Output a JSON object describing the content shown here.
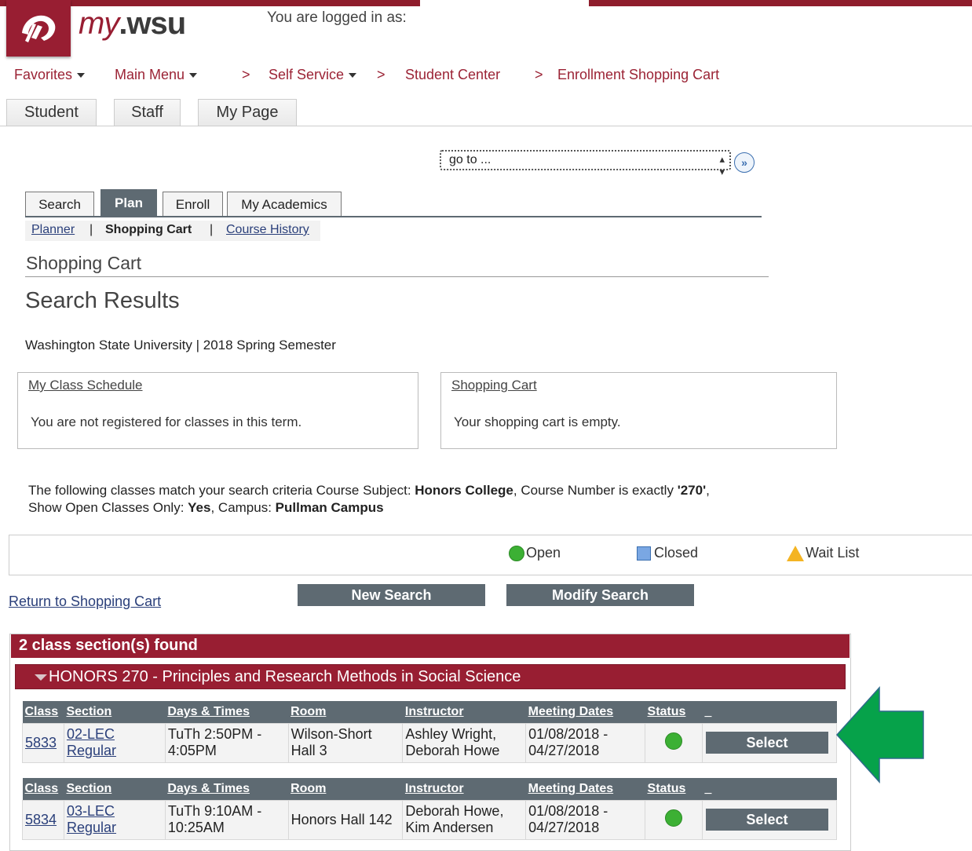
{
  "header": {
    "logo_text_my": "my",
    "logo_text_wsu": ".wsu",
    "logged_in_label": "You are logged in as:"
  },
  "nav": {
    "favorites": "Favorites",
    "main_menu": "Main Menu",
    "self_service": "Self Service",
    "student_center": "Student Center",
    "enrollment_cart": "Enrollment Shopping Cart",
    "separator": ">"
  },
  "top_tabs": [
    "Student",
    "Staff",
    "My Page"
  ],
  "goto": {
    "value": "go to ...",
    "button_symbol": "»"
  },
  "sub_tabs": {
    "search": "Search",
    "plan": "Plan",
    "enroll": "Enroll",
    "my_academics": "My Academics"
  },
  "sub_nav": {
    "planner": "Planner",
    "shopping_cart": "Shopping Cart",
    "course_history": "Course History",
    "separator": "|"
  },
  "page": {
    "section_title": "Shopping Cart",
    "results_title": "Search Results",
    "term": "Washington State University | 2018 Spring Semester"
  },
  "schedule_box": {
    "title": "My Class Schedule",
    "body": "You are not registered for classes in this term."
  },
  "cart_box": {
    "title": "Shopping Cart",
    "body": "Your shopping cart is empty."
  },
  "criteria": {
    "t1": "The following classes match your search criteria Course Subject: ",
    "subject": "Honors College",
    "t2": ",  Course Number is exactly ",
    "number": "'270'",
    "t3": ",  Show Open Classes Only: ",
    "open_only": "Yes",
    "t4": ",  Campus: ",
    "campus": "Pullman Campus"
  },
  "legend": {
    "open": "Open",
    "closed": "Closed",
    "wait_list": "Wait List"
  },
  "actions": {
    "return": "Return to Shopping Cart",
    "new_search": "New Search",
    "modify_search": "Modify Search"
  },
  "results": {
    "count_label": "2 class section(s) found",
    "course_title": "HONORS 270 - Principles and Research Methods in Social Science",
    "columns": [
      "Class",
      "Section",
      "Days & Times",
      "Room",
      "Instructor",
      "Meeting Dates",
      "Status",
      "_"
    ],
    "rows": [
      {
        "class": "5833",
        "section_1": "02-LEC",
        "section_2": "Regular",
        "days_1": "TuTh 2:50PM -",
        "days_2": "4:05PM",
        "room_1": "Wilson-Short",
        "room_2": "Hall 3",
        "instr_1": "Ashley Wright,",
        "instr_2": "Deborah Howe",
        "dates_1": "01/08/2018 -",
        "dates_2": "04/27/2018",
        "select": "Select"
      },
      {
        "class": "5834",
        "section_1": "03-LEC",
        "section_2": "Regular",
        "days_1": "TuTh 9:10AM -",
        "days_2": "10:25AM",
        "room_1": "Honors Hall 142",
        "room_2": "",
        "instr_1": "Deborah Howe,",
        "instr_2": "Kim Andersen",
        "dates_1": "01/08/2018 -",
        "dates_2": "04/27/2018",
        "select": "Select"
      }
    ]
  },
  "colors": {
    "brand_crimson": "#981e32",
    "button_gray": "#5e6a72",
    "status_open_green": "#3cb034",
    "arrow_green": "#06a24a"
  }
}
